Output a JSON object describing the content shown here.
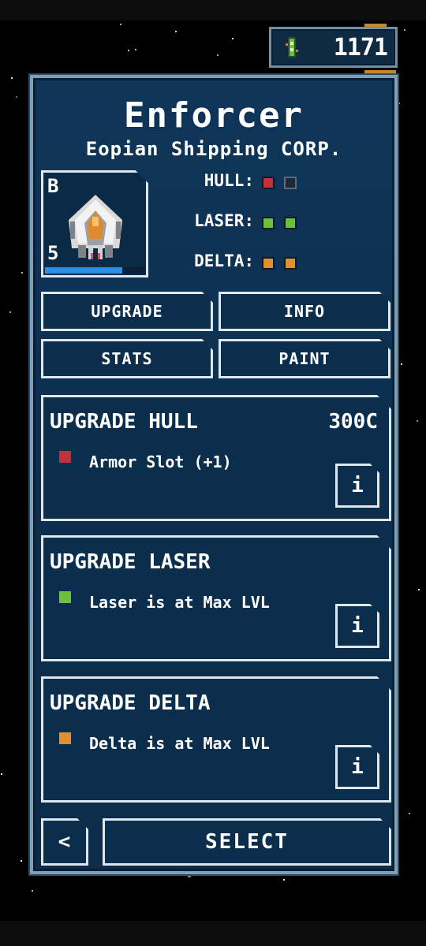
{
  "currency": {
    "value": "1171",
    "icon": "credit-chip-icon"
  },
  "ship": {
    "name": "Enforcer",
    "manufacturer": "Eopian Shipping CORP.",
    "rank": "B",
    "level": "5",
    "xp_progress": 0.78
  },
  "stats": [
    {
      "label": "HULL:",
      "color": "#c2303a",
      "filled": 1,
      "total": 2
    },
    {
      "label": "LASER:",
      "color": "#6fbf3f",
      "filled": 2,
      "total": 2
    },
    {
      "label": "DELTA:",
      "color": "#e0912f",
      "filled": 2,
      "total": 2
    }
  ],
  "tabs": {
    "upgrade": "UPGRADE",
    "info": "INFO",
    "stats": "STATS",
    "paint": "PAINT"
  },
  "upgrades": [
    {
      "title": "UPGRADE HULL",
      "cost": "300C",
      "desc": "Armor Slot (+1)",
      "color": "#c2303a",
      "info": "i"
    },
    {
      "title": "UPGRADE LASER",
      "cost": "",
      "desc": "Laser is at Max LVL",
      "color": "#6fbf3f",
      "info": "i"
    },
    {
      "title": "UPGRADE DELTA",
      "cost": "",
      "desc": "Delta is at Max LVL",
      "color": "#e0912f",
      "info": "i"
    }
  ],
  "footer": {
    "back": "<",
    "select": "SELECT"
  }
}
